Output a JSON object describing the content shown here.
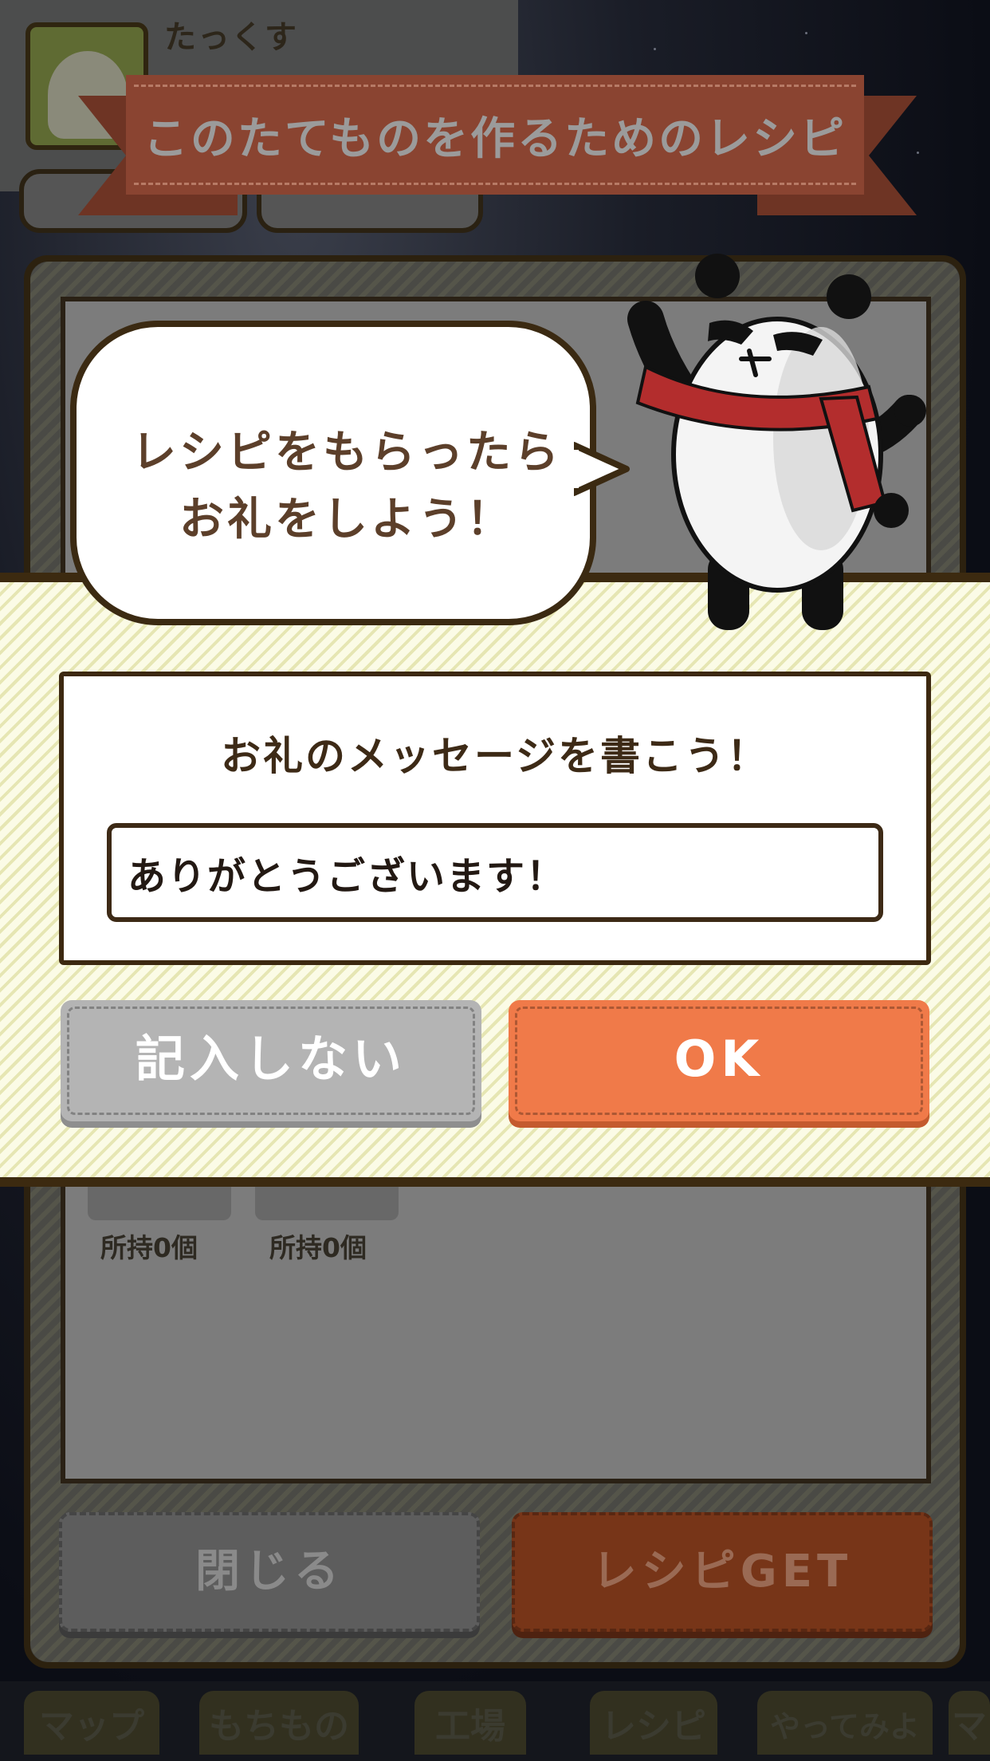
{
  "profile": {
    "username": "たっくす"
  },
  "background_buttons": {
    "close_label": "閉じる",
    "recipe_get_label": "レシピGET"
  },
  "owned_items": [
    {
      "label": "所持0個"
    },
    {
      "label": "所持0個"
    }
  ],
  "title_ribbon": {
    "text": "このたてものを作るためのレシピ"
  },
  "speech_bubble": {
    "line1": "レシピをもらったら",
    "line2": "お礼をしよう！"
  },
  "message_dialog": {
    "title": "お礼のメッセージを書こう！",
    "input_value": "ありがとうございます！",
    "skip_label": "記入しない",
    "ok_label": "OK"
  },
  "bottom_nav": {
    "tabs": [
      "マップ",
      "もちもの",
      "工場",
      "レシピ",
      "やってみよう",
      "マ"
    ]
  },
  "colors": {
    "ok_button": "#f07a49",
    "skip_button": "#b4b4b4",
    "outline_brown": "#3c2a10",
    "bubble_text": "#5c3f2a",
    "scarf": "#b32d2d"
  },
  "icons": [
    "panda-mascot-icon",
    "user-avatar-icon"
  ]
}
